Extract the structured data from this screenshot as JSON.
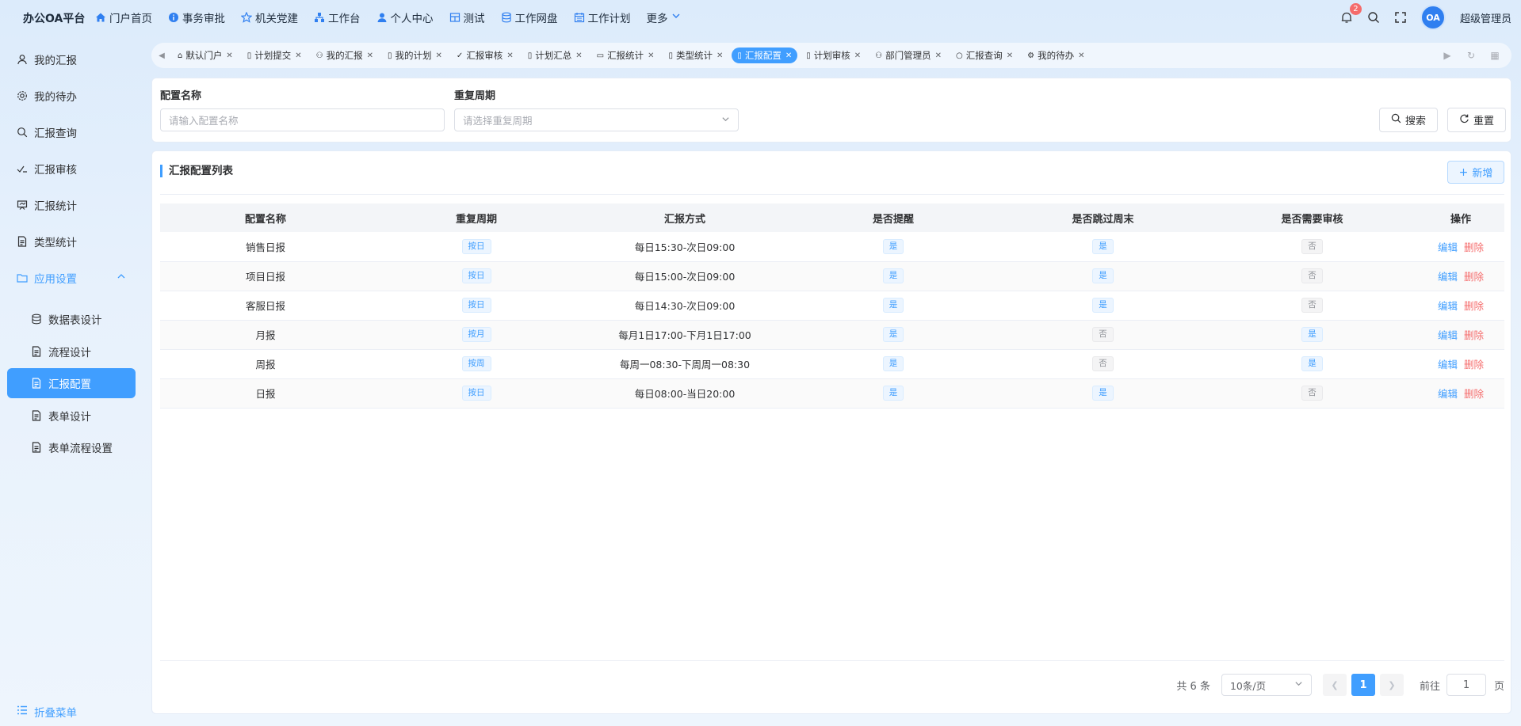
{
  "app": {
    "brand": "办公OA平台"
  },
  "topnav": [
    {
      "label": "门户首页",
      "icon": "home-icon"
    },
    {
      "label": "事务审批",
      "icon": "info-icon"
    },
    {
      "label": "机关党建",
      "icon": "star-icon"
    },
    {
      "label": "工作台",
      "icon": "workbench-icon"
    },
    {
      "label": "个人中心",
      "icon": "user-icon"
    },
    {
      "label": "测试",
      "icon": "grid-icon"
    },
    {
      "label": "工作网盘",
      "icon": "database-icon"
    },
    {
      "label": "工作计划",
      "icon": "calendar-icon"
    }
  ],
  "more_label": "更多",
  "user": {
    "notification_count": "2",
    "avatar_text": "OA",
    "name": "超级管理员"
  },
  "sidebar": {
    "items": [
      {
        "label": "我的汇报",
        "icon": "user-icon"
      },
      {
        "label": "我的待办",
        "icon": "gear-icon"
      },
      {
        "label": "汇报查询",
        "icon": "search-icon"
      },
      {
        "label": "汇报审核",
        "icon": "check-icon"
      },
      {
        "label": "汇报统计",
        "icon": "chart-icon"
      },
      {
        "label": "类型统计",
        "icon": "document-icon"
      },
      {
        "label": "应用设置",
        "icon": "folder-icon"
      }
    ],
    "sub_items": [
      {
        "label": "数据表设计",
        "icon": "database-icon"
      },
      {
        "label": "流程设计",
        "icon": "document-icon"
      },
      {
        "label": "汇报配置",
        "icon": "document-icon"
      },
      {
        "label": "表单设计",
        "icon": "document-icon"
      },
      {
        "label": "表单流程设置",
        "icon": "document-icon"
      }
    ],
    "collapse_label": "折叠菜单"
  },
  "tabs": [
    {
      "label": "默认门户"
    },
    {
      "label": "计划提交"
    },
    {
      "label": "我的汇报"
    },
    {
      "label": "我的计划"
    },
    {
      "label": "汇报审核"
    },
    {
      "label": "计划汇总"
    },
    {
      "label": "汇报统计"
    },
    {
      "label": "类型统计"
    },
    {
      "label": "汇报配置"
    },
    {
      "label": "计划审核"
    },
    {
      "label": "部门管理员"
    },
    {
      "label": "汇报查询"
    },
    {
      "label": "我的待办"
    }
  ],
  "search": {
    "name_label": "配置名称",
    "name_placeholder": "请输入配置名称",
    "cycle_label": "重复周期",
    "cycle_placeholder": "请选择重复周期",
    "search_label": "搜索",
    "reset_label": "重置"
  },
  "list": {
    "title": "汇报配置列表",
    "add_label": "新增",
    "columns": [
      "配置名称",
      "重复周期",
      "汇报方式",
      "是否提醒",
      "是否跳过周末",
      "是否需要审核",
      "操作"
    ],
    "rows": [
      {
        "name": "销售日报",
        "cycle": "按日",
        "method": "每日15:30-次日09:00",
        "remind": "是",
        "skip_weekend": "是",
        "need_audit": "否"
      },
      {
        "name": "项目日报",
        "cycle": "按日",
        "method": "每日15:00-次日09:00",
        "remind": "是",
        "skip_weekend": "是",
        "need_audit": "否"
      },
      {
        "name": "客服日报",
        "cycle": "按日",
        "method": "每日14:30-次日09:00",
        "remind": "是",
        "skip_weekend": "是",
        "need_audit": "否"
      },
      {
        "name": "月报",
        "cycle": "按月",
        "method": "每月1日17:00-下月1日17:00",
        "remind": "是",
        "skip_weekend": "否",
        "need_audit": "是"
      },
      {
        "name": "周报",
        "cycle": "按周",
        "method": "每周一08:30-下周周一08:30",
        "remind": "是",
        "skip_weekend": "否",
        "need_audit": "是"
      },
      {
        "name": "日报",
        "cycle": "按日",
        "method": "每日08:00-当日20:00",
        "remind": "是",
        "skip_weekend": "是",
        "need_audit": "否"
      }
    ],
    "edit_label": "编辑",
    "delete_label": "删除"
  },
  "pagination": {
    "total_text": "共 6 条",
    "page_size": "10条/页",
    "current_page": "1",
    "goto_label": "前往",
    "goto_value": "1",
    "page_suffix": "页"
  },
  "colors": {
    "primary": "#409eff",
    "danger": "#f56c6c"
  }
}
